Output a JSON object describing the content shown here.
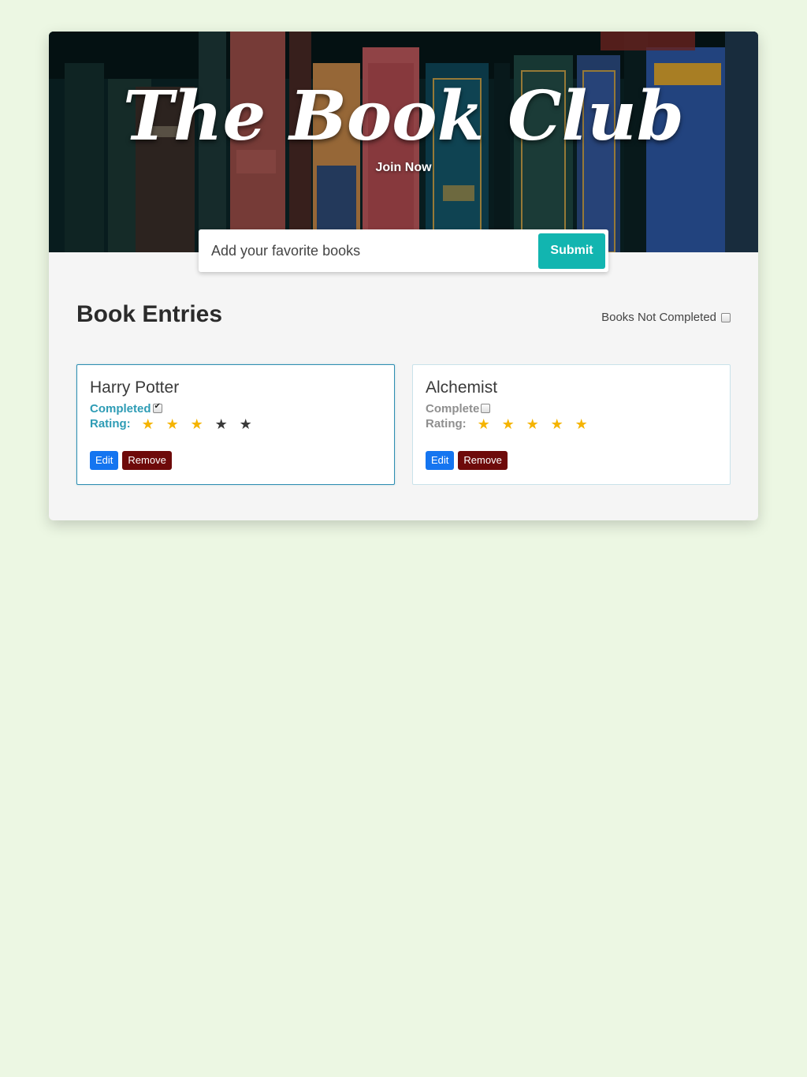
{
  "hero": {
    "title": "The Book Club",
    "join_label": "Join Now"
  },
  "add_book": {
    "placeholder": "Add your favorite books",
    "submit_label": "Submit"
  },
  "entries": {
    "title": "Book Entries",
    "filter_label": "Books Not Completed",
    "filter_checked": false
  },
  "books": [
    {
      "title": "Harry Potter",
      "status_label": "Completed",
      "completed": true,
      "rating_label": "Rating:",
      "rating": 3,
      "max_rating": 5,
      "edit_label": "Edit",
      "remove_label": "Remove"
    },
    {
      "title": "Alchemist",
      "status_label": "Complete",
      "completed": false,
      "rating_label": "Rating:",
      "rating": 5,
      "max_rating": 5,
      "edit_label": "Edit",
      "remove_label": "Remove"
    }
  ],
  "colors": {
    "page_background": "#ecf7e3",
    "accent_teal": "#12b5b0",
    "completed_text": "#2e9cb5",
    "star_filled": "#f5b400",
    "star_empty": "#3a3a3a",
    "edit_button": "#1575f0",
    "remove_button": "#6e0a0a"
  },
  "icons": {
    "star": "star-icon",
    "checkbox": "checkbox-icon"
  }
}
